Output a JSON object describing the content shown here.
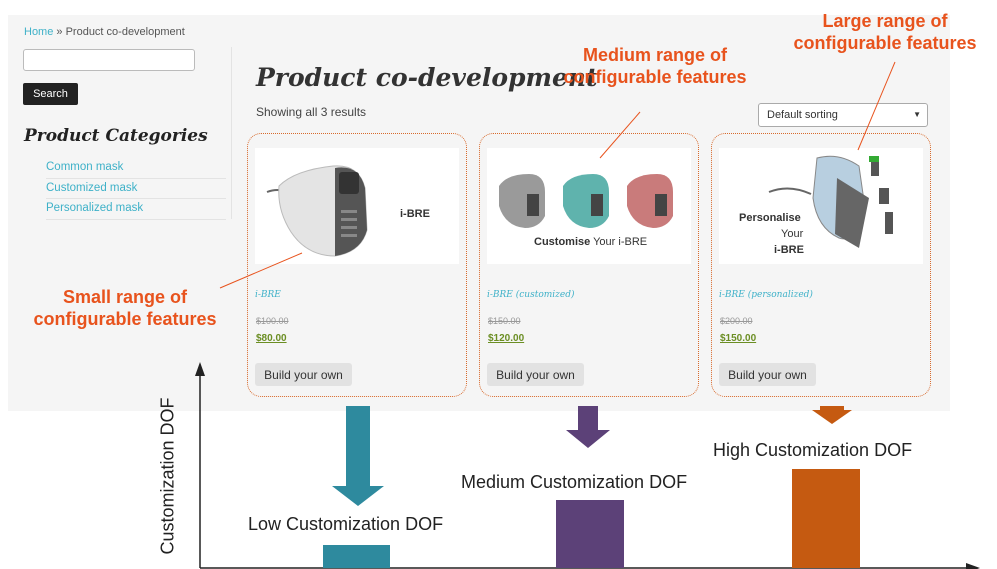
{
  "breadcrumb": {
    "home": "Home",
    "separator": " » ",
    "current": "Product co-development"
  },
  "search": {
    "placeholder": "",
    "button_label": "Search"
  },
  "categories": {
    "title": "Product Categories",
    "items": [
      {
        "label": "Common mask"
      },
      {
        "label": "Customized mask"
      },
      {
        "label": "Personalized mask"
      }
    ]
  },
  "main": {
    "title": "Product co-development",
    "results_text": "Showing all 3 results",
    "sort_selected": "Default sorting"
  },
  "products": [
    {
      "name": "i-BRE",
      "old_price": "$100.00",
      "price": "$80.00",
      "button": "Build your own",
      "image_text": "i-BRE"
    },
    {
      "name": "i-BRE (customized)",
      "old_price": "$150.00",
      "price": "$120.00",
      "button": "Build your own",
      "image_text_a": "Customise",
      "image_text_b": " Your i-BRE"
    },
    {
      "name": "i-BRE (personalized)",
      "old_price": "$200.00",
      "price": "$150.00",
      "button": "Build your own",
      "image_text": [
        "Personalise",
        "Your",
        "i-BRE"
      ]
    }
  ],
  "annotations": {
    "small": [
      "Small range of",
      "configurable features"
    ],
    "medium": [
      "Medium range of",
      "configurable features"
    ],
    "large": [
      "Large range of",
      "configurable features"
    ]
  },
  "diagram": {
    "y_axis_label": "Customization DOF",
    "levels": [
      {
        "label": "Low Customization DOF",
        "color": "#2e8a9e",
        "arrow_color": "#2e8a9e",
        "level": 1
      },
      {
        "label": "Medium Customization DOF",
        "color": "#5c4178",
        "arrow_color": "#5c4178",
        "level": 2
      },
      {
        "label": "High Customization DOF",
        "color": "#c55a11",
        "arrow_color": "#c55a11",
        "level": 3
      }
    ]
  },
  "colors": {
    "link": "#3eb1c8",
    "annotation": "#e8531d",
    "card_border": "#d86a2c"
  }
}
